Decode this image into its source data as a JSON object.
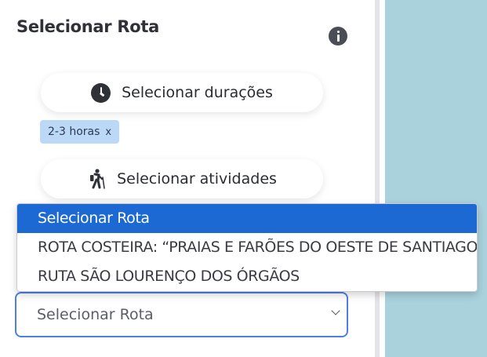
{
  "panel": {
    "title": "Selecionar Rota",
    "info_icon": "info-icon",
    "duration_button_label": "Selecionar durações",
    "duration_icon": "clock-icon",
    "duration_chip": {
      "label": "2-3 horas",
      "remove": "x"
    },
    "activity_button_label": "Selecionar atividades",
    "activity_icon": "hiker-icon",
    "route_select": {
      "value": "Selecionar Rota"
    }
  },
  "dropdown": {
    "options": [
      "Selecionar Rota",
      "ROTA COSTEIRA: “PRAIAS E FARÕES DO OESTE DE SANTIAGO”",
      "RUTA SÃO LOURENÇO DOS ÓRGÃOS"
    ],
    "selected_index": 0
  },
  "colors": {
    "map_water": "#a9d2dd",
    "selected_option": "#1c69d4",
    "chip_bg": "#bcd8f7",
    "select_border": "#4f7fe6"
  }
}
